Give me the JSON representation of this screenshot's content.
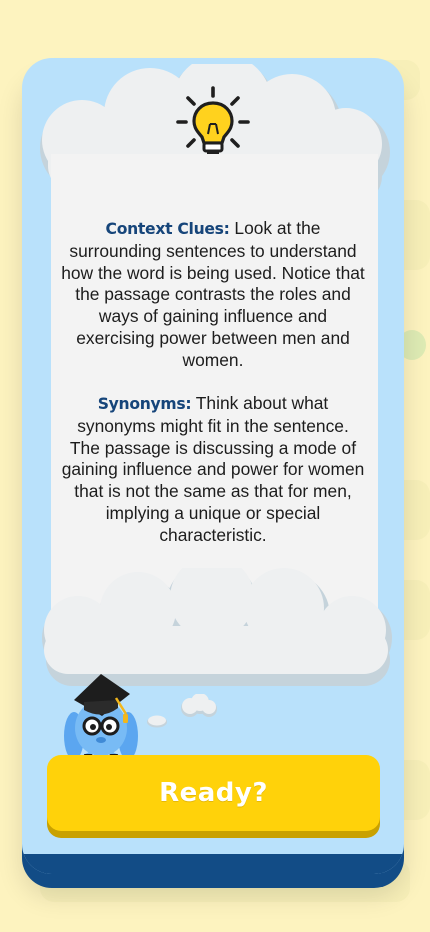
{
  "hints": [
    {
      "title": "Context Clues:",
      "text": " Look at the surrounding sentences to understand how the word is being used. Notice that the passage contrasts the roles and ways of gaining influence and exercising power between men and women."
    },
    {
      "title": "Synonyms:",
      "text": " Think about what synonyms might fit in the sentence. The passage is discussing a mode of gaining influence and power for women that is not the same as that for men, implying a unique or special characteristic."
    }
  ],
  "ready_button": {
    "label": "Ready?"
  },
  "icons": {
    "top": "lightbulb-icon",
    "mascot": "graduate-mascot"
  },
  "colors": {
    "background": "#fdf3bf",
    "dialog": "#b9e1fb",
    "dialog_edge": "#124c86",
    "hint_title": "#16457a",
    "button": "#ffd20a",
    "button_shadow": "#c9a100"
  }
}
